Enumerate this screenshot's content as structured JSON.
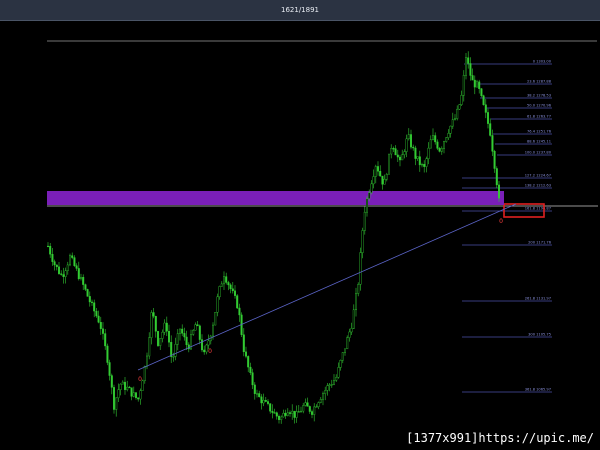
{
  "window": {
    "title": "1621/1891"
  },
  "watermark": "[1377x991]https://upic.me/",
  "chart_data": {
    "type": "candlestick",
    "candle_color": "#33cc33",
    "price_range": [
      1176.7,
      1315.0
    ],
    "fib_levels": [
      {
        "label": "0 1303.00",
        "price": 1303.0
      },
      {
        "label": "23.6 1287.88",
        "price": 1287.88
      },
      {
        "label": "38.2 1278.53",
        "price": 1278.53
      },
      {
        "label": "50.0 1270.96",
        "price": 1270.96
      },
      {
        "label": "61.8 1263.77",
        "price": 1263.77
      },
      {
        "label": "76.4 1251.76",
        "price": 1251.76
      },
      {
        "label": "88.6 1245.11",
        "price": 1245.11
      },
      {
        "label": "100.0 1237.80",
        "price": 1237.8
      },
      {
        "label": "127.2 1224.67",
        "price": 1224.67
      },
      {
        "label": "138.2 1212.63",
        "price": 1212.63
      },
      {
        "label": "161.8 1196.87",
        "price": 1196.87
      },
      {
        "label": "200 1171.76",
        "price": 1171.76
      },
      {
        "label": "261.8 1131.97",
        "price": 1131.97
      },
      {
        "label": "300 1105.75",
        "price": 1105.75
      },
      {
        "label": "361.8 1065.97",
        "price": 1065.97
      }
    ],
    "highlighted_level": "161.8 1196.87",
    "supply_zone": {
      "color": "#7a1fb8"
    },
    "trendline_color": "#5b64c8",
    "marker_symbol": "0",
    "marker_color": "#ff4040"
  }
}
